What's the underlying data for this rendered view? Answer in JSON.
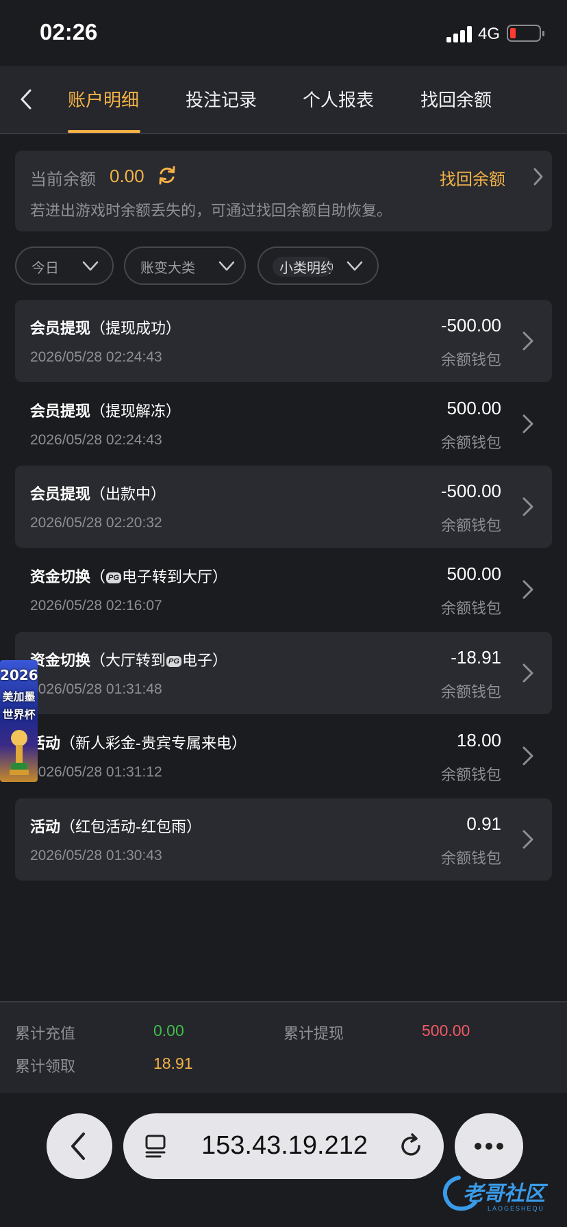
{
  "status_bar": {
    "time": "02:26",
    "network": "4G"
  },
  "tabs": [
    {
      "label": "账户明细",
      "active": true
    },
    {
      "label": "投注记录",
      "active": false
    },
    {
      "label": "个人报表",
      "active": false
    },
    {
      "label": "找回余额",
      "active": false
    }
  ],
  "balance": {
    "label": "当前余额",
    "value": "0.00",
    "recover_label": "找回余额",
    "hint": "若进出游戏时余额丢失的，可通过找回余额自助恢复。"
  },
  "filters": {
    "date": "今日",
    "category": "账变大类",
    "subcategory": "小类明约"
  },
  "records": [
    {
      "title": "会员提现",
      "detail_prefix": "（提现成功）",
      "detail_suffix": "",
      "icon": "",
      "time": "2026/05/28 02:24:43",
      "amount": "-500.00",
      "wallet": "余额钱包"
    },
    {
      "title": "会员提现",
      "detail_prefix": "（提现解冻）",
      "detail_suffix": "",
      "icon": "",
      "time": "2026/05/28 02:24:43",
      "amount": "500.00",
      "wallet": "余额钱包"
    },
    {
      "title": "会员提现",
      "detail_prefix": "（出款中）",
      "detail_suffix": "",
      "icon": "",
      "time": "2026/05/28 02:20:32",
      "amount": "-500.00",
      "wallet": "余额钱包"
    },
    {
      "title": "资金切换",
      "detail_prefix": "（",
      "detail_suffix": "电子转到大厅）",
      "icon": "PG",
      "time": "2026/05/28 02:16:07",
      "amount": "500.00",
      "wallet": "余额钱包"
    },
    {
      "title": "资金切换",
      "detail_prefix": "（大厅转到",
      "detail_suffix": "电子）",
      "icon": "PG",
      "time": "2026/05/28 01:31:48",
      "amount": "-18.91",
      "wallet": "余额钱包"
    },
    {
      "title": "活动",
      "detail_prefix": "（新人彩金-贵宾专属来电）",
      "detail_suffix": "",
      "icon": "",
      "time": "2026/05/28 01:31:12",
      "amount": "18.00",
      "wallet": "余额钱包"
    },
    {
      "title": "活动",
      "detail_prefix": "（红包活动-红包雨）",
      "detail_suffix": "",
      "icon": "",
      "time": "2026/05/28 01:30:43",
      "amount": "0.91",
      "wallet": "余额钱包"
    }
  ],
  "promo": {
    "line1": "2026",
    "line2": "美加墨",
    "line3": "世界杯"
  },
  "summary": {
    "deposit_label": "累计充值",
    "deposit_value": "0.00",
    "withdraw_label": "累计提现",
    "withdraw_value": "500.00",
    "bonus_label": "累计领取",
    "bonus_value": "18.91"
  },
  "browser": {
    "url": "153.43.19.212"
  },
  "watermark": {
    "text": "老哥社区",
    "sub": "LAOGESHEQU"
  },
  "colors": {
    "accent": "#f4b247",
    "green": "#3fbf4a",
    "red": "#f05a64",
    "background": "#1b1c20"
  }
}
